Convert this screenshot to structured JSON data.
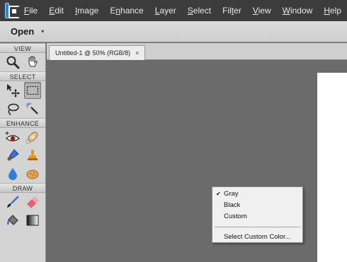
{
  "menubar": {
    "app_icon": "photoshop-elements-logo",
    "items": [
      {
        "label": "File",
        "name": "menu-file"
      },
      {
        "label": "Edit",
        "name": "menu-edit"
      },
      {
        "label": "Image",
        "name": "menu-image"
      },
      {
        "label": "Enhance",
        "name": "menu-enhance"
      },
      {
        "label": "Layer",
        "name": "menu-layer"
      },
      {
        "label": "Select",
        "name": "menu-select"
      },
      {
        "label": "Filter",
        "name": "menu-filter"
      },
      {
        "label": "View",
        "name": "menu-view"
      },
      {
        "label": "Window",
        "name": "menu-window"
      },
      {
        "label": "Help",
        "name": "menu-help"
      }
    ]
  },
  "optbar": {
    "open_label": "Open",
    "open_arrow": "▾"
  },
  "toolbox": {
    "sections": {
      "view": "VIEW",
      "select": "SELECT",
      "enhance": "ENHANCE",
      "draw": "DRAW"
    },
    "tools": [
      "zoom-icon",
      "hand-icon",
      "move-icon",
      "rectangular-marquee-icon",
      "lasso-icon",
      "magic-wand-icon",
      "red-eye-removal-icon",
      "spot-healing-brush-icon",
      "smart-brush-icon",
      "clone-stamp-icon",
      "blur-icon",
      "sponge-icon",
      "brush-icon",
      "eraser-icon",
      "paint-bucket-icon",
      "gradient-icon"
    ],
    "active_tool": "rectangular-marquee-icon"
  },
  "document_tab": {
    "title": "Untitled-1 @ 50% (RGB/8)",
    "close": "×"
  },
  "context_menu": {
    "items": [
      {
        "label": "Gray",
        "checked": true
      },
      {
        "label": "Black",
        "checked": false
      },
      {
        "label": "Custom",
        "checked": false
      },
      {
        "label": "Select Custom Color...",
        "checked": false
      }
    ],
    "check_glyph": "✔"
  },
  "colors": {
    "menubar_bg": "#3c3c3c",
    "canvas_bg": "#6b6b6b",
    "accent_blue": "#1c8ad8"
  }
}
